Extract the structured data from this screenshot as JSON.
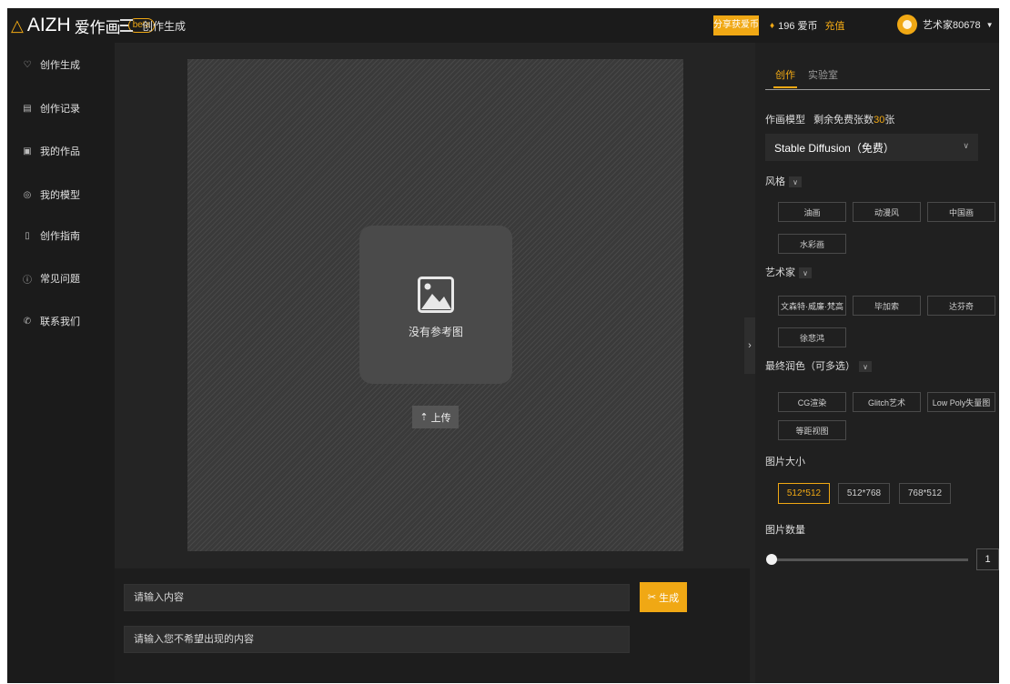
{
  "header": {
    "logo_text": "AIZH",
    "logo_cn": "爱作画",
    "beta": "beta",
    "breadcrumb": "创作生成",
    "share_label": "分享获爱币",
    "coins": "196 爱币",
    "recharge": "充值",
    "username": "艺术家80678"
  },
  "sidebar": {
    "items": [
      {
        "label": "创作生成",
        "icon": "bulb-icon",
        "glyph": "♡"
      },
      {
        "label": "创作记录",
        "icon": "record-icon",
        "glyph": "▤"
      },
      {
        "label": "我的作品",
        "icon": "gallery-icon",
        "glyph": "▣"
      },
      {
        "label": "我的模型",
        "icon": "model-icon",
        "glyph": "◎"
      },
      {
        "label": "创作指南",
        "icon": "guide-icon",
        "glyph": "▯"
      },
      {
        "label": "常见问题",
        "icon": "faq-icon",
        "glyph": "ⓘ"
      },
      {
        "label": "联系我们",
        "icon": "phone-icon",
        "glyph": "✆"
      }
    ]
  },
  "main": {
    "no_reference": "没有参考图",
    "upload": "上传",
    "prompt_placeholder": "请输入内容",
    "negative_placeholder": "请输入您不希望出现的内容",
    "generate": "生成"
  },
  "panel": {
    "tabs": [
      "创作",
      "实验室"
    ],
    "model_label": "作画模型",
    "free_label": "剩余免费张数",
    "free_count": "30",
    "free_unit": "张",
    "model_value": "Stable Diffusion（免费）",
    "style_label": "风格",
    "styles": [
      "油画",
      "动漫风",
      "中国画",
      "水彩画"
    ],
    "artist_label": "艺术家",
    "artists": [
      "文森特·威廉·梵高",
      "毕加索",
      "达芬奇",
      "徐悲鸿"
    ],
    "finish_label": "最终润色（可多选）",
    "finishes": [
      "CG渲染",
      "Glitch艺术",
      "Low Poly失量图",
      "等距视图"
    ],
    "size_label": "图片大小",
    "sizes": [
      "512*512",
      "512*768",
      "768*512"
    ],
    "active_size": "512*512",
    "count_label": "图片数量",
    "count_value": "1"
  },
  "colors": {
    "accent": "#f0a814",
    "background": "#242424",
    "sidebar": "#1b1b1b"
  }
}
